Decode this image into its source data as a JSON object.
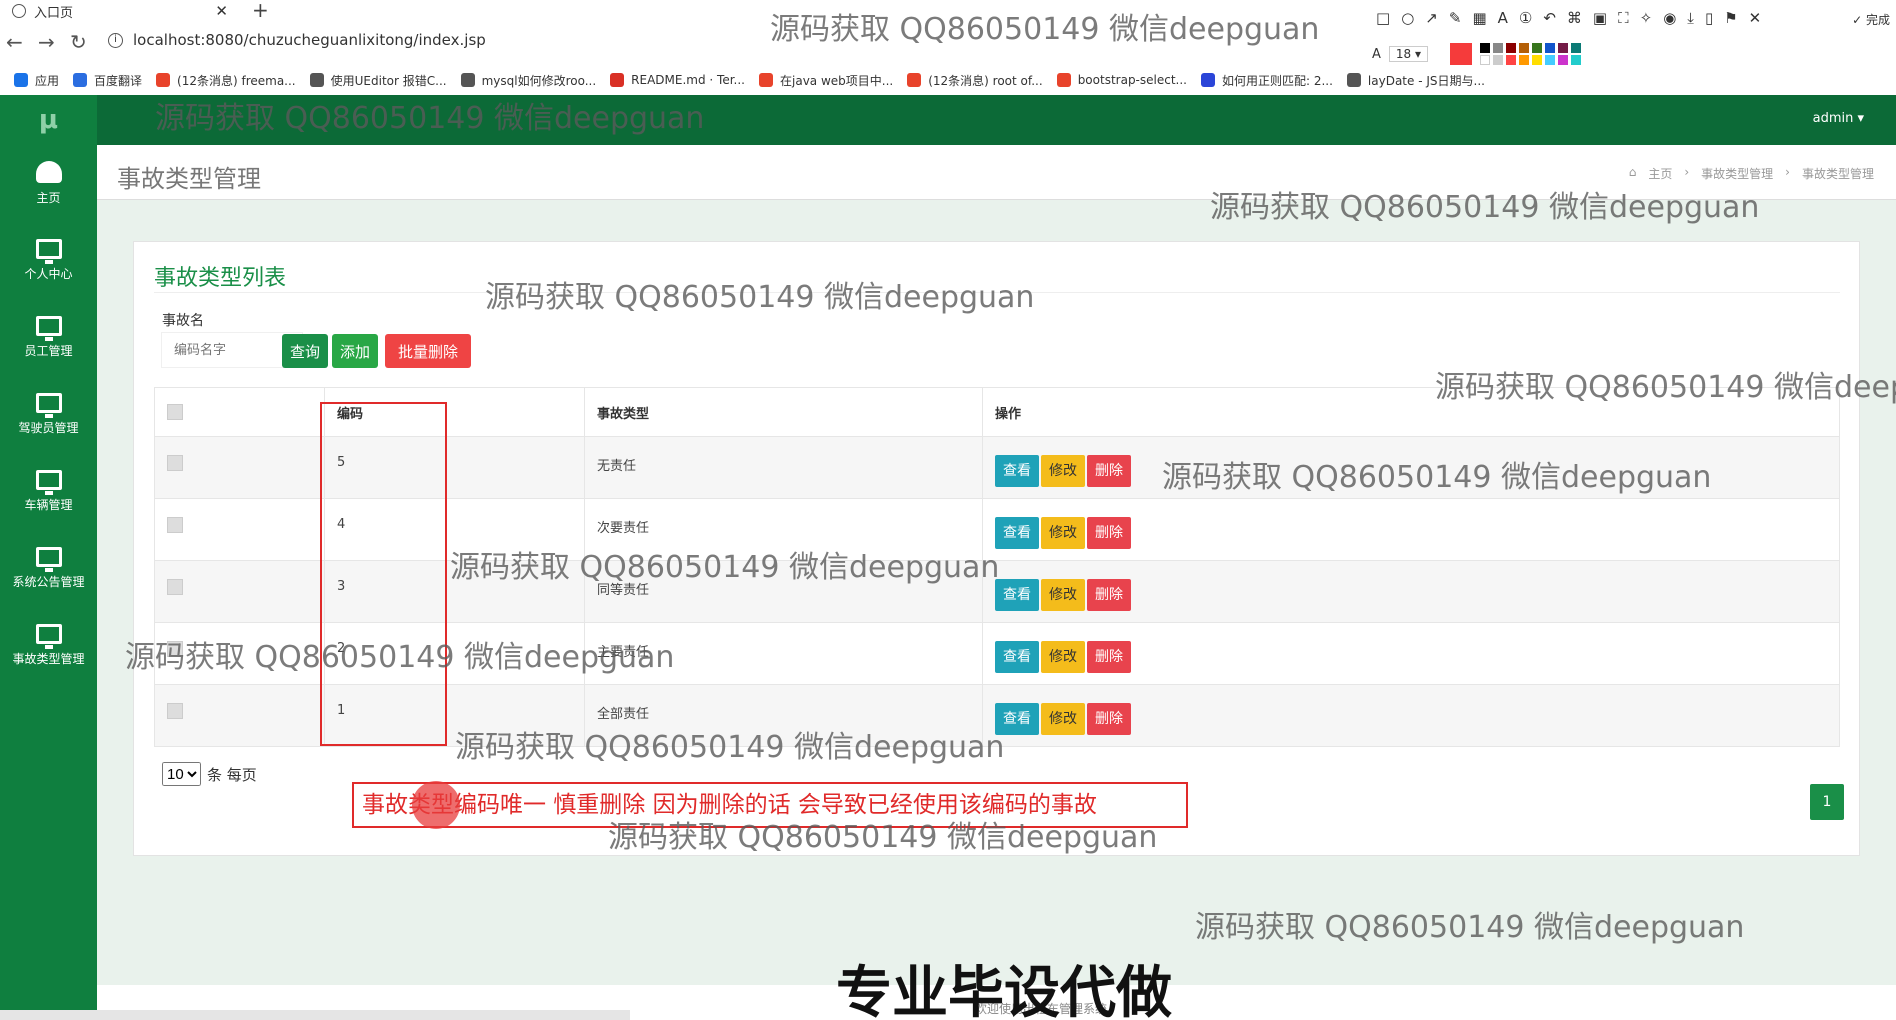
{
  "browser": {
    "tab_title": "入口页",
    "url": "localhost:8080/chuzucheguanlixitong/index.jsp",
    "bookmarks": [
      {
        "label": "应用",
        "color": "#1a73e8"
      },
      {
        "label": "百度翻译",
        "color": "#2b6de0"
      },
      {
        "label": "(12条消息) freema...",
        "color": "#e8432b"
      },
      {
        "label": "使用UEditor 报错C...",
        "color": "#555555"
      },
      {
        "label": "mysql如何修改roo...",
        "color": "#555555"
      },
      {
        "label": "README.md · Ter...",
        "color": "#d93025"
      },
      {
        "label": "在java web项目中...",
        "color": "#e8432b"
      },
      {
        "label": "(12条消息) root of...",
        "color": "#e8432b"
      },
      {
        "label": "bootstrap-select...",
        "color": "#e8432b"
      },
      {
        "label": "如何用正则匹配: 2...",
        "color": "#2b45d8"
      },
      {
        "label": "layDate - JS日期与...",
        "color": "#555555"
      }
    ]
  },
  "screenshot_tool": {
    "done_label": "完成",
    "font_size": "18"
  },
  "sidebar": {
    "logo": "μ",
    "items": [
      {
        "label": "主页",
        "icon": "dashboard-icon"
      },
      {
        "label": "个人中心",
        "icon": "monitor-icon"
      },
      {
        "label": "员工管理",
        "icon": "monitor-icon"
      },
      {
        "label": "驾驶员管理",
        "icon": "monitor-icon"
      },
      {
        "label": "车辆管理",
        "icon": "monitor-icon"
      },
      {
        "label": "系统公告管理",
        "icon": "monitor-icon"
      },
      {
        "label": "事故类型管理",
        "icon": "monitor-icon"
      }
    ]
  },
  "topbar": {
    "user_label": "admin ▾"
  },
  "page": {
    "title": "事故类型管理",
    "breadcrumb": [
      "主页",
      "事故类型管理",
      "事故类型管理"
    ]
  },
  "panel": {
    "title": "事故类型列表",
    "filter_label": "事故名",
    "search_placeholder": "编码名字",
    "query_label": "查询",
    "add_label": "添加",
    "batch_delete_label": "批量删除",
    "columns": [
      "编码",
      "事故类型",
      "操作"
    ],
    "rows": [
      {
        "code": "5",
        "type": "无责任"
      },
      {
        "code": "4",
        "type": "次要责任"
      },
      {
        "code": "3",
        "type": "同等责任"
      },
      {
        "code": "2",
        "type": "主要责任"
      },
      {
        "code": "1",
        "type": "全部责任"
      }
    ],
    "actions": {
      "view": "查看",
      "edit": "修改",
      "delete": "删除"
    },
    "page_size": "10",
    "page_size_suffix": "条 每页",
    "current_page": "1"
  },
  "annotation": {
    "note": "事故类型编码唯一  慎重删除 因为删除的话 会导致已经使用该编码的事故"
  },
  "watermark": "源码获取 QQ86050149 微信deepguan",
  "caption": "专业毕设代做",
  "footer": "欢迎使用出租车管理系统",
  "colors": {
    "sidebar": "#0f7f3f",
    "topbar": "#0c6a37",
    "accent": "#1a8f48",
    "view_button": "#1fa2b8",
    "edit_button": "#f4bc1b",
    "delete_button": "#e8434d"
  }
}
